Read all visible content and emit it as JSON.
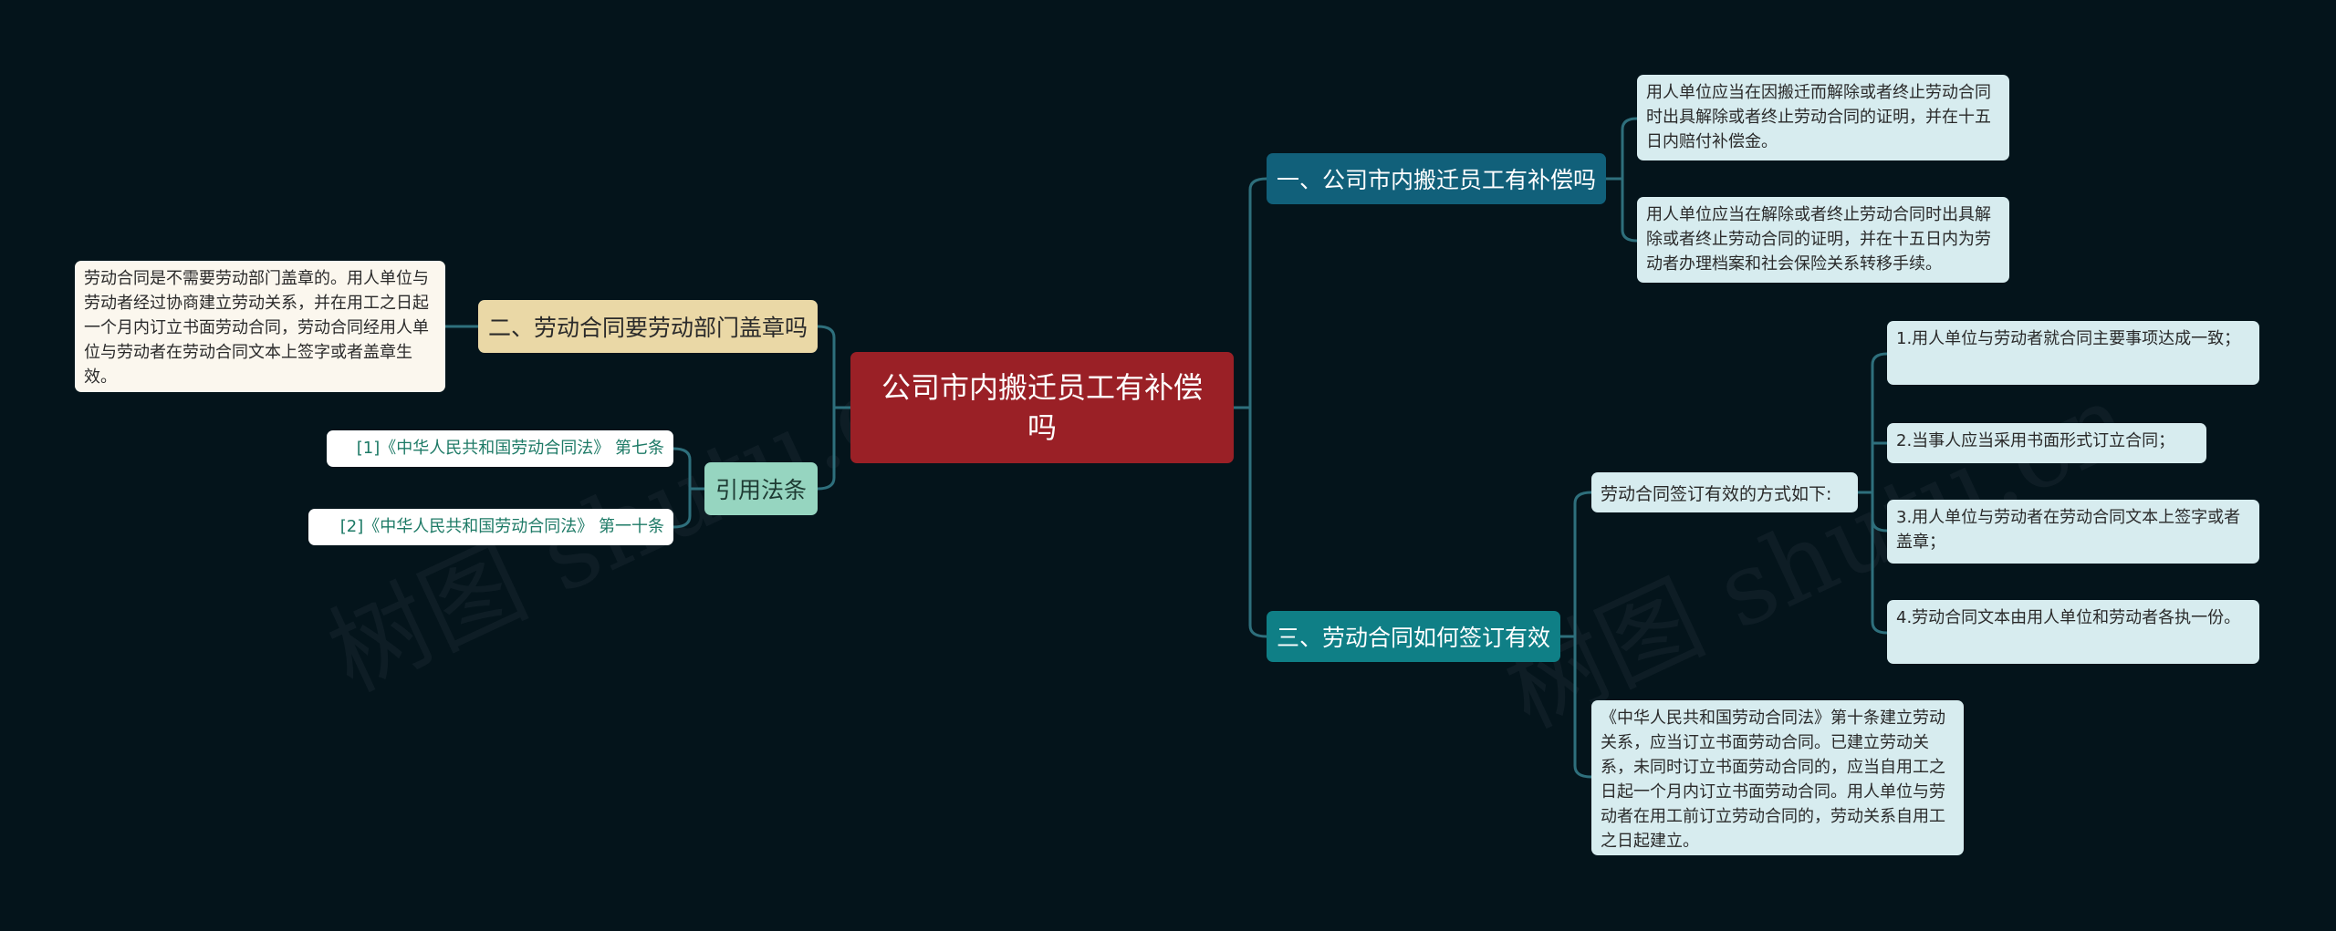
{
  "root": {
    "label": "公司市内搬迁员工有补偿吗"
  },
  "branch1": {
    "label": "一、公司市内搬迁员工有补偿吗",
    "leaves": [
      "用人单位应当在因搬迁而解除或者终止劳动合同时出具解除或者终止劳动合同的证明，并在十五日内赔付补偿金。",
      "用人单位应当在解除或者终止劳动合同时出具解除或者终止劳动合同的证明，并在十五日内为劳动者办理档案和社会保险关系转移手续。"
    ]
  },
  "branch2": {
    "label": "二、劳动合同要劳动部门盖章吗",
    "leaf": "劳动合同是不需要劳动部门盖章的。用人单位与劳动者经过协商建立劳动关系，并在用工之日起一个月内订立书面劳动合同，劳动合同经用人单位与劳动者在劳动合同文本上签字或者盖章生效。"
  },
  "branch3": {
    "label": "三、劳动合同如何签订有效",
    "mid": "劳动合同签订有效的方式如下:",
    "steps": [
      "1.用人单位与劳动者就合同主要事项达成一致；",
      "2.当事人应当采用书面形式订立合同；",
      "3.用人单位与劳动者在劳动合同文本上签字或者盖章；",
      "4.劳动合同文本由用人单位和劳动者各执一份。"
    ],
    "leaf": "《中华人民共和国劳动合同法》第十条建立劳动关系，应当订立书面劳动合同。已建立劳动关系，未同时订立书面劳动合同的，应当自用工之日起一个月内订立书面劳动合同。用人单位与劳动者在用工前订立劳动合同的，劳动关系自用工之日起建立。"
  },
  "branch4": {
    "label": "引用法条",
    "refs": [
      "[1]《中华人民共和国劳动合同法》 第七条",
      "[2]《中华人民共和国劳动合同法》 第一十条"
    ]
  },
  "watermark": "树图 shutu.cn",
  "colors": {
    "background": "#04141b",
    "root": "#9a2026",
    "line": "#2e6f7c"
  }
}
